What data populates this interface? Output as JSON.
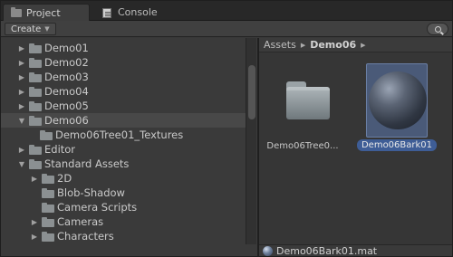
{
  "tabs": [
    {
      "label": "Project",
      "icon": "folder-icon",
      "active": true
    },
    {
      "label": "Console",
      "icon": "console-icon",
      "active": false
    }
  ],
  "toolbar": {
    "create_label": "Create",
    "search_icon": "search-icon"
  },
  "tree": {
    "items": [
      {
        "label": "Demo01",
        "indent": 1,
        "expanded": false
      },
      {
        "label": "Demo02",
        "indent": 1,
        "expanded": false
      },
      {
        "label": "Demo03",
        "indent": 1,
        "expanded": false
      },
      {
        "label": "Demo04",
        "indent": 1,
        "expanded": false
      },
      {
        "label": "Demo05",
        "indent": 1,
        "expanded": false
      },
      {
        "label": "Demo06",
        "indent": 1,
        "expanded": true,
        "selected": true
      },
      {
        "label": "Demo06Tree01_Textures",
        "indent": 2,
        "expanded": false,
        "leaf": true
      },
      {
        "label": "Editor",
        "indent": 1,
        "expanded": false
      },
      {
        "label": "Standard Assets",
        "indent": 1,
        "expanded": true
      },
      {
        "label": "2D",
        "indent": 2,
        "expanded": false
      },
      {
        "label": "Blob-Shadow",
        "indent": 2,
        "expanded": false,
        "leaf": true
      },
      {
        "label": "Camera Scripts",
        "indent": 2,
        "expanded": false,
        "leaf": true
      },
      {
        "label": "Cameras",
        "indent": 2,
        "expanded": false
      },
      {
        "label": "Characters",
        "indent": 2,
        "expanded": false
      }
    ]
  },
  "breadcrumb": {
    "root": "Assets",
    "current": "Demo06"
  },
  "assets": [
    {
      "name": "Demo06Tree0...",
      "kind": "folder",
      "selected": false
    },
    {
      "name": "Demo06Bark01",
      "kind": "material",
      "selected": true
    }
  ],
  "statusbar": {
    "selected_path": "Demo06Bark01.mat"
  },
  "colors": {
    "selection": "#3e5d96",
    "panel": "#383838"
  }
}
